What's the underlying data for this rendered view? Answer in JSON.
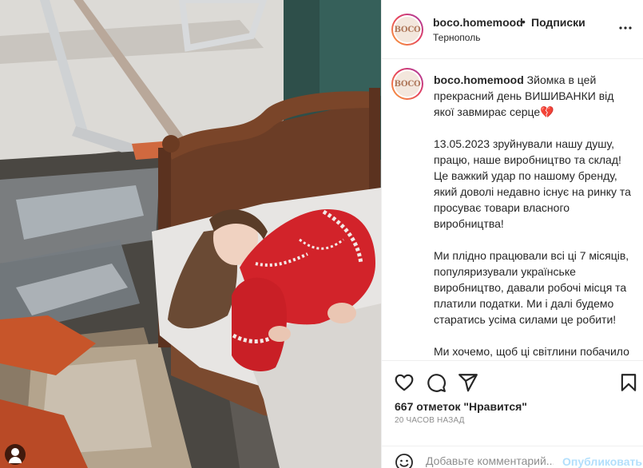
{
  "colors": {
    "accent": "#0095f6",
    "publish_disabled": "#b2dffc",
    "heart": "#e0245e",
    "dress_red": "#d2232a"
  },
  "post": {
    "username": "boco.homemood",
    "separator": "•",
    "follow_label": "Подписки",
    "location": "Тернополь",
    "avatar_text": "BOCO",
    "more_icon": "more-horizontal-icon"
  },
  "caption": {
    "username": "boco.homemood",
    "lead": "Зйомка в цей прекрасний день ВИШИВАНКИ від якої завмирає серце",
    "lead_emoji": "💔",
    "paragraphs": [
      "13.05.2023 зруйнували нашу душу, працю, наше виробництво та склад! Це важкий удар по нашому бренду, який доволі недавно існує на ринку та просуває товари власного виробництва!",
      "Ми плідно працювали всі ці 7 місяців, популяризували українське виробництво, давали робочі місця та платили податки. Ми і далі будемо старатись усіма силами це робити!",
      "Ми хочемо, щоб ці світлини побачило як можна більше людей, щоб люди ще раз нагадали собі, яку"
    ]
  },
  "actions": {
    "icons": [
      "heart-icon",
      "comment-icon",
      "share-icon",
      "bookmark-icon"
    ],
    "likes_text": "667 отметок \"Нравится\"",
    "time_text": "20 ЧАСОВ НАЗАД"
  },
  "comment": {
    "placeholder": "Добавьте комментарий...",
    "publish_label": "Опубликовать",
    "emoji_icon": "emoji-icon"
  }
}
